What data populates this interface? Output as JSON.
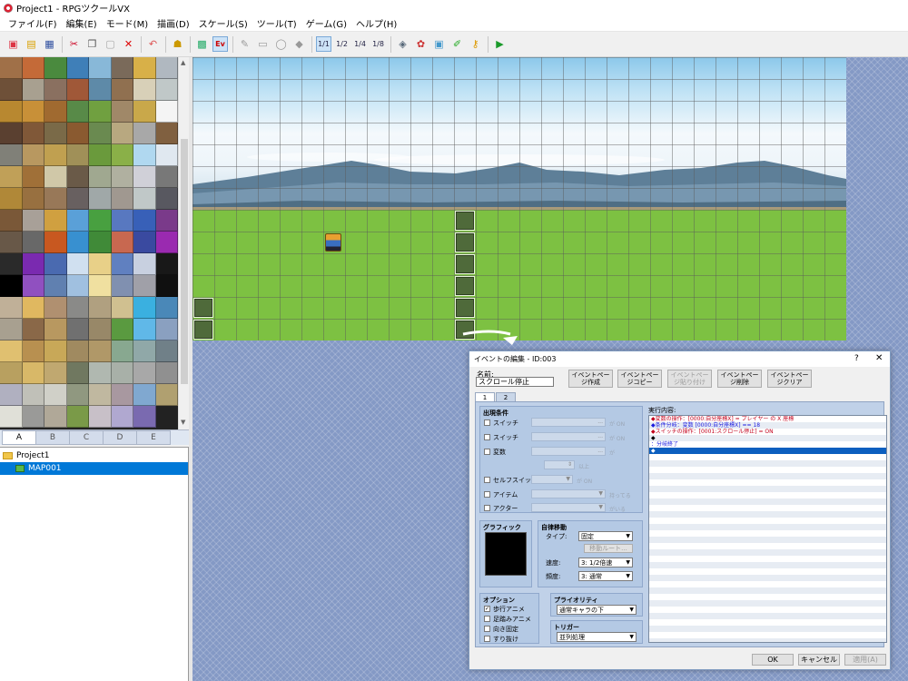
{
  "window": {
    "title": "Project1 - RPGツクールVX"
  },
  "menu": [
    "ファイル(F)",
    "編集(E)",
    "モード(M)",
    "描画(D)",
    "スケール(S)",
    "ツール(T)",
    "ゲーム(G)",
    "ヘルプ(H)"
  ],
  "toolbar": {
    "scale_1_1": "1/1",
    "scale_1_2": "1/2",
    "scale_1_4": "1/4",
    "scale_1_8": "1/8",
    "event_mode": "Ev"
  },
  "tileset_tabs": [
    "A",
    "B",
    "C",
    "D",
    "E"
  ],
  "tileset_colors": [
    "#a07048",
    "#c46a38",
    "#4a8a3e",
    "#3f7fb8",
    "#88b8d8",
    "#7a6a5a",
    "#d8b048",
    "#b0b8c0",
    "#6e5038",
    "#a8a090",
    "#8a7060",
    "#a05838",
    "#5e8aa8",
    "#907050",
    "#d8d0b8",
    "#c0c8c8",
    "#b88830",
    "#c89038",
    "#a06a30",
    "#588a48",
    "#70a040",
    "#a08868",
    "#c9a84a",
    "#f4f4f4",
    "#5a4030",
    "#805838",
    "#7a6a48",
    "#8a5a30",
    "#6a8a50",
    "#b8a880",
    "#a8a8a8",
    "#806040",
    "#808078",
    "#b89860",
    "#c0a050",
    "#a09058",
    "#6a9a3c",
    "#8ab048",
    "#b0d8f0",
    "#e0e8f0",
    "#c0a058",
    "#a07038",
    "#d0c8a8",
    "#6a5a48",
    "#a0a890",
    "#b0b0a0",
    "#d0d0d8",
    "#787878",
    "#b08838",
    "#987040",
    "#987858",
    "#686060",
    "#a0a8a8",
    "#a09890",
    "#c0c8c8",
    "#585860",
    "#7a5838",
    "#a8a098",
    "#d0a040",
    "#5aa0d8",
    "#48a040",
    "#5878c0",
    "#3860b8",
    "#7a3a8a",
    "#685848",
    "#686868",
    "#c85820",
    "#3890d0",
    "#408a38",
    "#c86850",
    "#3a4aa0",
    "#9a2ab0",
    "#2a2a2a",
    "#7a2ab0",
    "#4a6ab0",
    "#d0e0f0",
    "#e8d088",
    "#6080c0",
    "#c8d0e0",
    "#181818",
    "#000000",
    "#9050c0",
    "#6080b0",
    "#a0c0e0",
    "#f0e0a0",
    "#8090b0",
    "#a0a0a8",
    "#101010",
    "#c0b098",
    "#e0b860",
    "#b09070",
    "#8a8a88",
    "#b0a080",
    "#d0c090",
    "#3ab0e0",
    "#4a88b8",
    "#a8a090",
    "#8a6848",
    "#b89860",
    "#707070",
    "#988868",
    "#5a9a40",
    "#60b8e8",
    "#8aa0c0",
    "#e0c070",
    "#b89050",
    "#c8a858",
    "#a08a60",
    "#b09868",
    "#88a890",
    "#90a8a8",
    "#708088",
    "#b8a060",
    "#d8b868",
    "#c0a870",
    "#707860",
    "#b0b8b0",
    "#a8b0a8",
    "#a8a8a8",
    "#909090",
    "#b0b0c0",
    "#c0c0b8",
    "#d0d0c8",
    "#909880",
    "#c0b8a0",
    "#a898a0",
    "#80a8d0",
    "#b0a070",
    "#e0e0d8",
    "#9a9a98",
    "#b0a898",
    "#7a9a48",
    "#c8c0c8",
    "#b0a8d0",
    "#7a6ab0"
  ],
  "map_tree": {
    "project": "Project1",
    "map": "MAP001"
  },
  "dialog": {
    "title": "イベントの編集 - ID:003",
    "help": "?",
    "close": "✕",
    "name_label": "名前:",
    "name_value": "スクロール停止",
    "btn_new_page": "イベントページ作成",
    "btn_copy_page": "イベントページコピー",
    "btn_paste_page": "イベントページ貼り付け",
    "btn_delete_page": "イベントページ削除",
    "btn_clear_page": "イベントページクリア",
    "tabs": [
      "1",
      "2"
    ],
    "conditions": {
      "title": "出現条件",
      "switch1": "スイッチ",
      "switch2": "スイッチ",
      "variable": "変数",
      "self_switch": "セルフスイッチ",
      "item": "アイテム",
      "actor": "アクター",
      "unit_on": "が ON",
      "unit_ga": "が",
      "unit_ijou": "以上",
      "unit_on2": "が ON",
      "unit_motteiru": "持ってる",
      "unit_iru": "がいる"
    },
    "graphic_title": "グラフィック",
    "autonomous": {
      "title": "自律移動",
      "type_label": "タイプ:",
      "type_value": "固定",
      "route_btn": "移動ルート...",
      "speed_label": "速度:",
      "speed_value": "3: 1/2倍速",
      "freq_label": "頻度:",
      "freq_value": "3: 通常"
    },
    "options": {
      "title": "オプション",
      "walk_anim": "歩行アニメ",
      "step_anim": "足踏みアニメ",
      "dir_fix": "向き固定",
      "through": "すり抜け"
    },
    "priority": {
      "title": "プライオリティ",
      "value": "通常キャラの下"
    },
    "trigger": {
      "title": "トリガー",
      "value": "並列処理"
    },
    "contents_label": "実行内容:",
    "commands": [
      "◆変数の操作：[0000:自分座標X] = プレイヤー の X 座標",
      "◆条件分岐：変数 [0000:自分座標X] == 18",
      "  ◆スイッチの操作：[0001:スクロール停止] = ON",
      "  ◆",
      "：分岐終了",
      "◆"
    ],
    "ok": "OK",
    "cancel": "キャンセル",
    "apply": "適用(A)"
  }
}
